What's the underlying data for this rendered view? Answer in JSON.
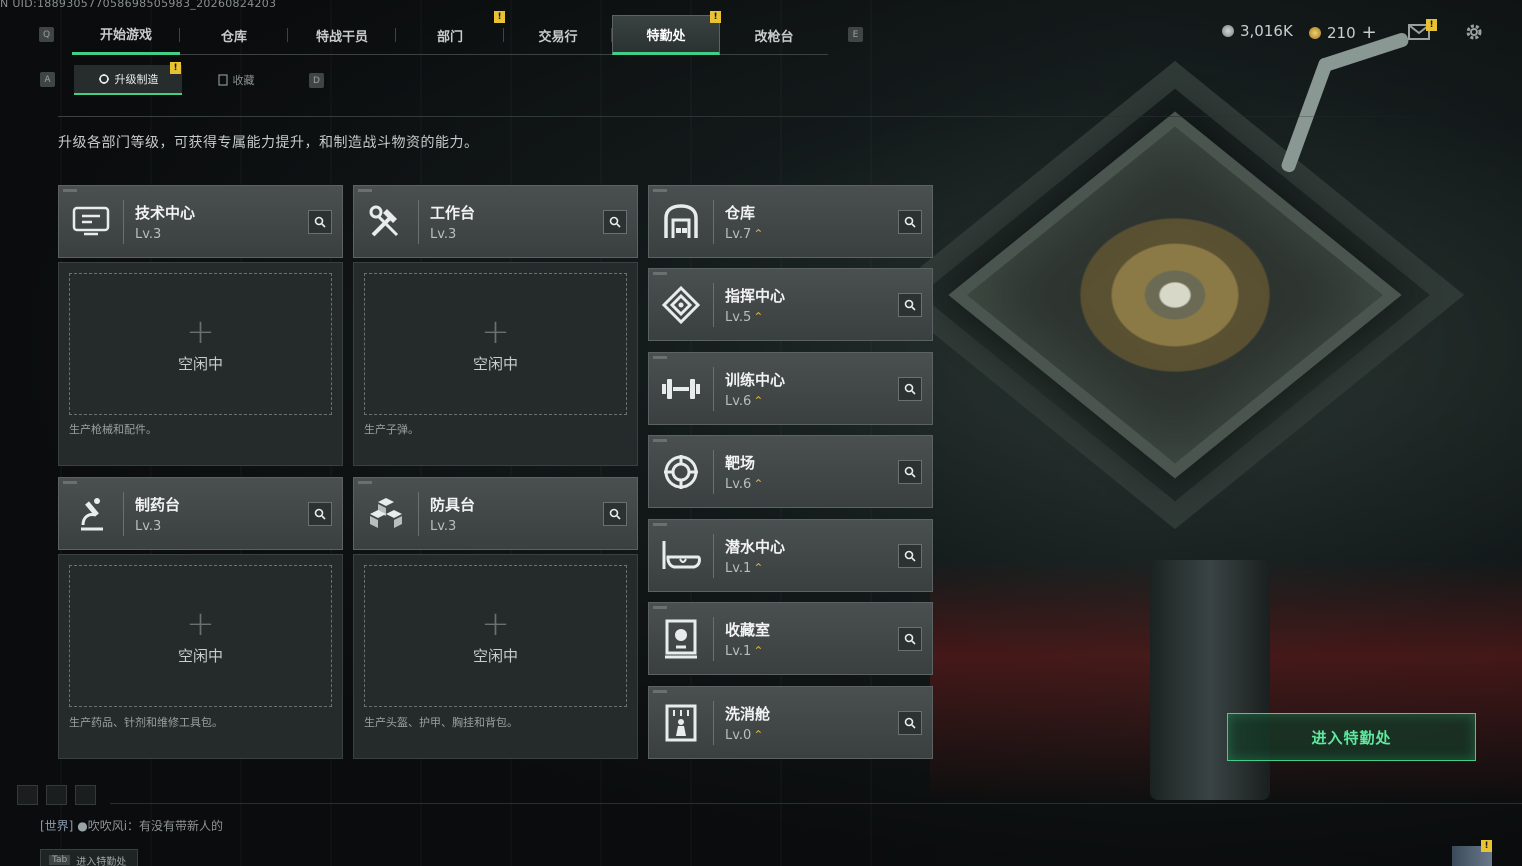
{
  "uid": "N UID:188930577058698505983_20260824203",
  "nav": {
    "tabs": [
      "开始游戏",
      "仓库",
      "特战干员",
      "部门",
      "交易行",
      "特勤处",
      "改枪台"
    ],
    "active_tab": "特勤处",
    "key_left": "Q",
    "key_right": "E"
  },
  "currency": {
    "silver": "3,016K",
    "gold": "210",
    "add": "+"
  },
  "subnav": {
    "tabs": [
      "升级制造",
      "收藏"
    ],
    "key_left": "A",
    "key_right": "D"
  },
  "description": "升级各部门等级，可获得专属能力提升，和制造战斗物资的能力。",
  "idle_label": "空闲中",
  "plus_symbol": "+",
  "production": [
    {
      "name": "技术中心",
      "level": "Lv.3",
      "icon": "tech-center-icon",
      "note": "生产枪械和配件。"
    },
    {
      "name": "工作台",
      "level": "Lv.3",
      "icon": "workbench-icon",
      "note": "生产子弹。"
    },
    {
      "name": "制药台",
      "level": "Lv.3",
      "icon": "pharmacy-icon",
      "note": "生产药品、针剂和维修工具包。"
    },
    {
      "name": "防具台",
      "level": "Lv.3",
      "icon": "armor-bench-icon",
      "note": "生产头盔、护甲、胸挂和背包。"
    }
  ],
  "departments": [
    {
      "name": "仓库",
      "level": "Lv.7",
      "icon": "warehouse-icon"
    },
    {
      "name": "指挥中心",
      "level": "Lv.5",
      "icon": "command-center-icon"
    },
    {
      "name": "训练中心",
      "level": "Lv.6",
      "icon": "training-center-icon"
    },
    {
      "name": "靶场",
      "level": "Lv.6",
      "icon": "shooting-range-icon"
    },
    {
      "name": "潜水中心",
      "level": "Lv.1",
      "icon": "diving-center-icon"
    },
    {
      "name": "收藏室",
      "level": "Lv.1",
      "icon": "collection-room-icon"
    },
    {
      "name": "洗消舱",
      "level": "Lv.0",
      "icon": "decon-chamber-icon"
    }
  ],
  "upgrade_symbol": "⌃",
  "enter_button": "进入特勤处",
  "chat": {
    "channel": "[世界]",
    "user": "吹吹风i",
    "message": "：有没有带新人的"
  },
  "hotkey": {
    "key": "Tab",
    "label": "进入特勤处"
  },
  "badge_mark": "!",
  "colors": {
    "accent": "#3fcf88",
    "badge": "#e8c233",
    "upgrade": "#d8b240"
  }
}
